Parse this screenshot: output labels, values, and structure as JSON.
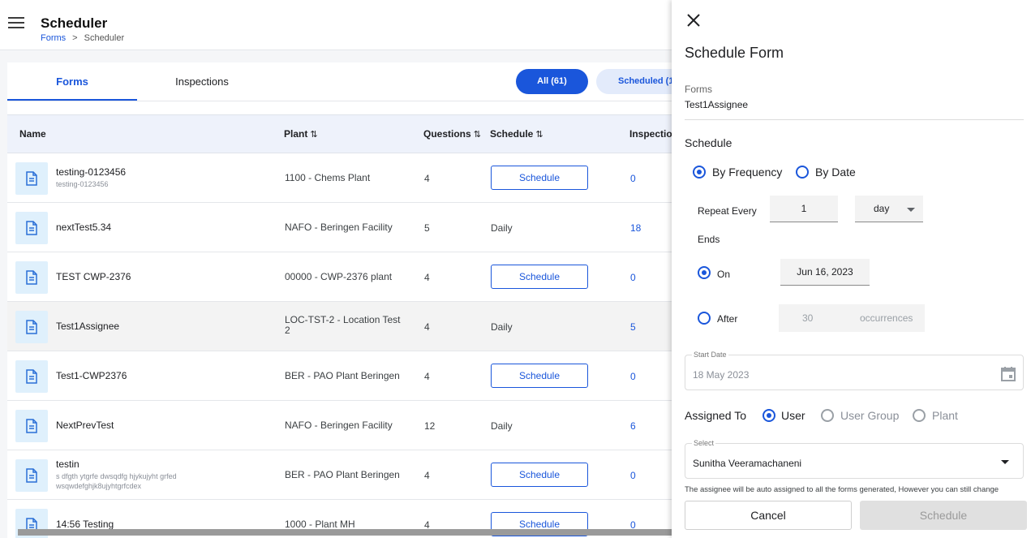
{
  "header": {
    "title": "Scheduler",
    "breadcrumb": {
      "link": "Forms",
      "separator": ">",
      "current": "Scheduler"
    }
  },
  "tabs": [
    {
      "label": "Forms",
      "active": true
    },
    {
      "label": "Inspections",
      "active": false
    }
  ],
  "filters": {
    "all": "All (61)",
    "scheduled": "Scheduled (1"
  },
  "table": {
    "columns": {
      "name": "Name",
      "plant": "Plant",
      "questions": "Questions",
      "schedule": "Schedule",
      "inspections": "Inspection",
      "sort_glyph": "⇅"
    },
    "schedule_button_label": "Schedule",
    "rows": [
      {
        "name": "testing-0123456",
        "sub": "testing-0123456",
        "plant": "1100 - Chems Plant",
        "questions": "4",
        "schedule": "",
        "inspections": "0"
      },
      {
        "name": "nextTest5.34",
        "sub": "",
        "plant": "NAFO - Beringen Facility",
        "questions": "5",
        "schedule": "Daily",
        "inspections": "18"
      },
      {
        "name": "TEST CWP-2376",
        "sub": "",
        "plant": "00000 - CWP-2376 plant",
        "questions": "4",
        "schedule": "",
        "inspections": "0"
      },
      {
        "name": "Test1Assignee",
        "sub": "",
        "plant": "LOC-TST-2 - Location Test 2",
        "questions": "4",
        "schedule": "Daily",
        "inspections": "5"
      },
      {
        "name": "Test1-CWP2376",
        "sub": "",
        "plant": "BER - PAO Plant Beringen",
        "questions": "4",
        "schedule": "",
        "inspections": "0"
      },
      {
        "name": "NextPrevTest",
        "sub": "",
        "plant": "NAFO - Beringen Facility",
        "questions": "12",
        "schedule": "Daily",
        "inspections": "6"
      },
      {
        "name": "testin",
        "sub": "s dfgth ytgrfe dwsqdfg hjykujyht grfed wsqwdefghjk8ujyhtgrfcdex",
        "plant": "BER - PAO Plant Beringen",
        "questions": "4",
        "schedule": "",
        "inspections": "0"
      },
      {
        "name": "14:56 Testing",
        "sub": "",
        "plant": "1000 - Plant MH",
        "questions": "4",
        "schedule": "",
        "inspections": "0"
      }
    ]
  },
  "drawer": {
    "title": "Schedule Form",
    "forms_label": "Forms",
    "form_name": "Test1Assignee",
    "schedule_section": "Schedule",
    "by_frequency": "By Frequency",
    "by_date": "By Date",
    "repeat_every_label": "Repeat Every",
    "repeat_value": "1",
    "repeat_unit": "day",
    "ends_label": "Ends",
    "on_label": "On",
    "on_date": "Jun 16, 2023",
    "after_label": "After",
    "after_count": "30",
    "occurrences_label": "occurrences",
    "start_date_label": "Start Date",
    "start_date_value": "18 May 2023",
    "assigned_to_label": "Assigned To",
    "assign_options": {
      "user": "User",
      "user_group": "User Group",
      "plant": "Plant"
    },
    "select_label": "Select",
    "select_value": "Sunitha Veeramachaneni",
    "note": "The assignee will be auto assigned to all the forms generated, However you can still change",
    "cancel_label": "Cancel",
    "schedule_label": "Schedule"
  },
  "colors": {
    "accent": "#1a56db",
    "header_row": "#eef2fb",
    "icon_bg": "#dff0fc"
  }
}
